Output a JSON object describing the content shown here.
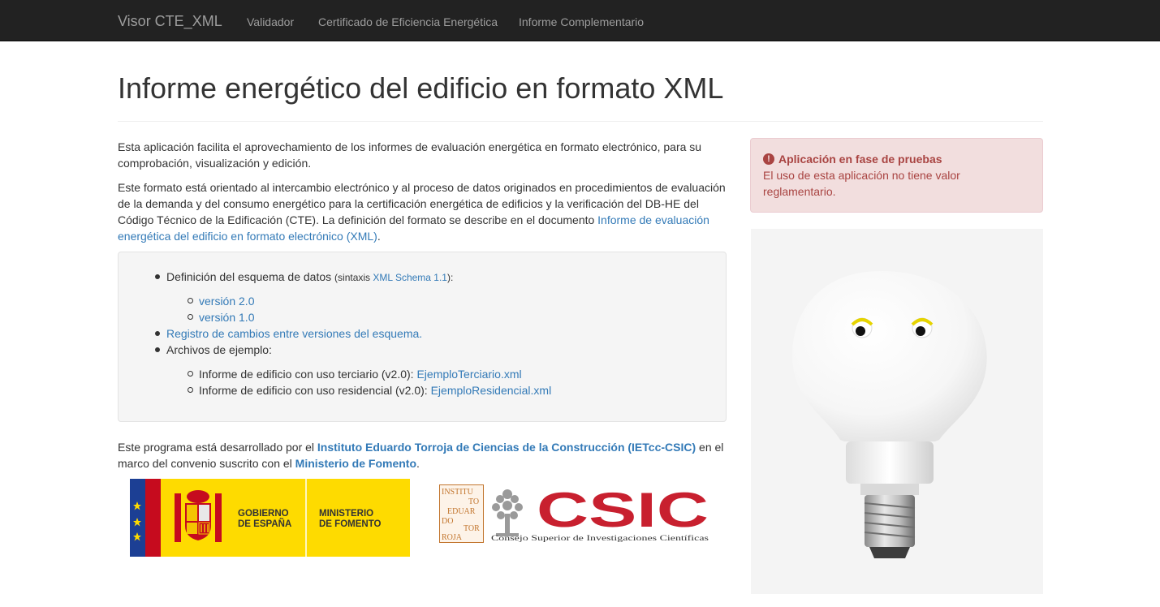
{
  "navbar": {
    "brand": "Visor CTE_XML",
    "links": [
      "Validador",
      "Certificado de Eficiencia Energética",
      "Informe Complementario"
    ]
  },
  "page": {
    "title": "Informe energético del edificio en formato XML"
  },
  "intro": {
    "p1": "Esta aplicación facilita el aprovechamiento de los informes de evaluación energética en formato electrónico, para su comprobación, visualización y edición.",
    "p2_text": "Este formato está orientado al intercambio electrónico y al proceso de datos originados en procedimientos de evaluación de la demanda y del consumo energético para la certificación energética de edificios y la verificación del DB-HE del Código Técnico de la Edificación (CTE). La definición del formato se describe en el documento ",
    "p2_link": "Informe de evaluación energética del edificio en formato electrónico (XML)",
    "p2_end": "."
  },
  "resources": {
    "schema_label": "Definición del esquema de datos",
    "schema_syntax_prefix": "(sintaxis ",
    "schema_syntax_link": "XML Schema 1.1",
    "schema_syntax_suffix": "):",
    "versions": [
      "versión 2.0",
      "versión 1.0"
    ],
    "changelog": "Registro de cambios entre versiones del esquema.",
    "examples_label": "Archivos de ejemplo:",
    "examples": [
      {
        "label": "Informe de edificio con uso terciario (v2.0): ",
        "file": "EjemploTerciario.xml"
      },
      {
        "label": "Informe de edificio con uso residencial (v2.0): ",
        "file": "EjemploResidencial.xml"
      }
    ]
  },
  "footer_text": {
    "prefix": "Este programa está desarrollado por el ",
    "org_link": "Instituto Eduardo Torroja de Ciencias de la Construcción (IETcc-CSIC)",
    "middle": " en el marco del convenio suscrito con el ",
    "ministry_link": "Ministerio de Fomento",
    "end": "."
  },
  "alert": {
    "icon": "exclamation-circle-icon",
    "title": "Aplicación en fase de pruebas",
    "body": "El uso de esta aplicación no tiene valor reglamentario."
  },
  "logos": {
    "gobierno_line1": "GOBIERNO",
    "gobierno_line2": "DE ESPAÑA",
    "ministerio_line1": "MINISTERIO",
    "ministerio_line2": "DE FOMENTO",
    "ietcc_lines": [
      "INSTITU",
      "TO",
      "EDUAR",
      "DO",
      "TOR",
      "ROJA"
    ],
    "csic": "CSIC",
    "csic_sub": "Consejo Superior de Investigaciones Científicas"
  },
  "colors": {
    "navbar_bg": "#222222",
    "link": "#337ab7",
    "alert_bg": "#f2dede",
    "alert_text": "#a94442",
    "csic_red": "#c8202f",
    "gov_yellow": "#fedb00"
  }
}
